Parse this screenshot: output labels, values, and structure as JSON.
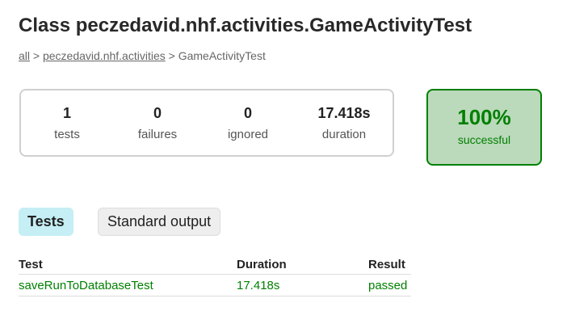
{
  "page": {
    "title": "Class peczedavid.nhf.activities.GameActivityTest"
  },
  "breadcrumb": {
    "root_link": "all",
    "sep1": " > ",
    "package_link": "peczedavid.nhf.activities",
    "sep2": " > ",
    "current": "GameActivityTest"
  },
  "summary": {
    "tests": {
      "value": "1",
      "label": "tests"
    },
    "failures": {
      "value": "0",
      "label": "failures"
    },
    "ignored": {
      "value": "0",
      "label": "ignored"
    },
    "duration": {
      "value": "17.418s",
      "label": "duration"
    }
  },
  "success": {
    "percent": "100%",
    "label": "successful"
  },
  "tabs": [
    {
      "label": "Tests",
      "active": true
    },
    {
      "label": "Standard output",
      "active": false
    }
  ],
  "table": {
    "headers": [
      "Test",
      "Duration",
      "Result"
    ],
    "rows": [
      {
        "test": "saveRunToDatabaseTest",
        "duration": "17.418s",
        "result": "passed"
      }
    ]
  },
  "colors": {
    "success_green": "#008000",
    "success_bg": "#bbd9bb",
    "active_tab_bg": "#c5eef5"
  }
}
